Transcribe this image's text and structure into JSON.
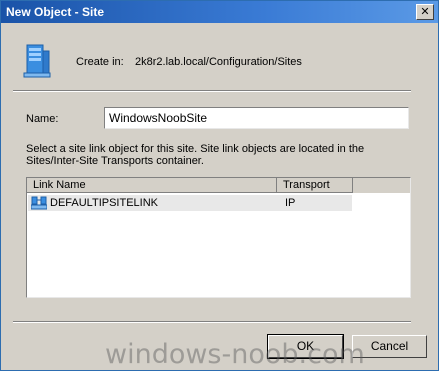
{
  "window": {
    "title": "New Object - Site",
    "close_glyph": "✕"
  },
  "header": {
    "icon": "site-object-icon",
    "create_in_label": "Create in:",
    "create_in_path": "2k8r2.lab.local/Configuration/Sites"
  },
  "form": {
    "name_label": "Name:",
    "name_value": "WindowsNoobSite",
    "instructions": "Select a site link object for this site. Site link objects are located in the Sites/Inter-Site Transports container."
  },
  "site_links": {
    "columns": [
      "Link Name",
      "Transport"
    ],
    "rows": [
      {
        "icon": "site-link-icon",
        "name": "DEFAULTIPSITELINK",
        "transport": "IP",
        "selected": true
      }
    ]
  },
  "buttons": {
    "ok": "OK",
    "cancel": "Cancel"
  },
  "watermark": "windows-noob.com",
  "colors": {
    "titlebar_start": "#1a53a8",
    "titlebar_end": "#5b9ae6",
    "dialog_bg": "#d4d0c8",
    "selection_bg": "#e8e8e8"
  }
}
